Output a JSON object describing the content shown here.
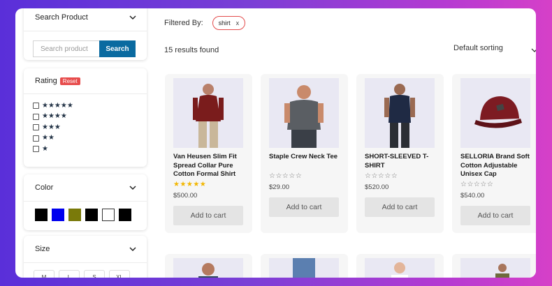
{
  "search": {
    "title": "Search Product",
    "placeholder": "Search product",
    "button": "Search"
  },
  "rating": {
    "title": "Rating",
    "reset": "Reset",
    "options": [
      "★★★★★",
      "★★★★",
      "★★★",
      "★★",
      "★"
    ]
  },
  "color": {
    "title": "Color",
    "swatches": [
      "#000000",
      "#0000ee",
      "#7a7a0a",
      "#000000",
      "#ffffff",
      "#000000"
    ]
  },
  "size": {
    "title": "Size",
    "options": [
      "M",
      "L",
      "S",
      "XL"
    ]
  },
  "filter": {
    "label": "Filtered By:",
    "chip": "shirt",
    "chip_close": "x"
  },
  "results_text": "15 results found",
  "sorting": "Default sorting",
  "products": [
    {
      "name": "Van Heusen Slim Fit Spread Collar Pure Cotton Formal Shirt",
      "stars": "★★★★★",
      "price": "$500.00",
      "cta": "Add to cart",
      "rated": true
    },
    {
      "name": "Staple Crew Neck Tee",
      "stars": "☆☆☆☆☆",
      "price": "$29.00",
      "cta": "Add to cart",
      "rated": false
    },
    {
      "name": "SHORT-SLEEVED T-SHIRT",
      "stars": "☆☆☆☆☆",
      "price": "$520.00",
      "cta": "Add to cart",
      "rated": false
    },
    {
      "name": "SELLORIA Brand Soft Cotton Adjustable Unisex Cap",
      "stars": "☆☆☆☆☆",
      "price": "$540.00",
      "cta": "Add to cart",
      "rated": false
    }
  ],
  "colors": {
    "accent": "#0a6aa0",
    "reset": "#e74c4c",
    "star_gold": "#f2b600",
    "star_outline": "#777777"
  }
}
